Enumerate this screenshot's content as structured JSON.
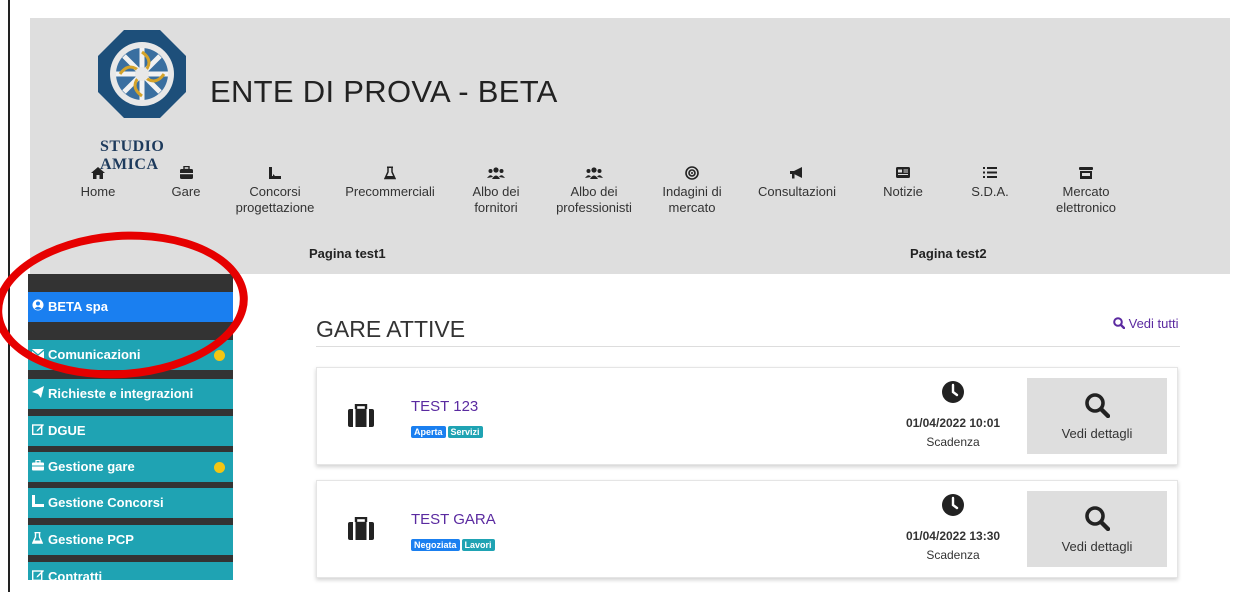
{
  "header": {
    "logo_text": "STUDIO AMICA",
    "site_title": "ENTE DI PROVA - BETA"
  },
  "nav": [
    {
      "label": "Home",
      "icon": "home-icon"
    },
    {
      "label": "Gare",
      "icon": "briefcase-icon"
    },
    {
      "label": "Concorsi progettazione",
      "icon": "drafting-icon"
    },
    {
      "label": "Precommerciali",
      "icon": "flask-icon"
    },
    {
      "label": "Albo dei fornitori",
      "icon": "users-icon"
    },
    {
      "label": "Albo dei professionisti",
      "icon": "users-icon"
    },
    {
      "label": "Indagini di mercato",
      "icon": "target-icon"
    },
    {
      "label": "Consultazioni",
      "icon": "megaphone-icon"
    },
    {
      "label": "Notizie",
      "icon": "newspaper-icon"
    },
    {
      "label": "S.D.A.",
      "icon": "list-icon"
    },
    {
      "label": "Mercato elettronico",
      "icon": "store-icon"
    }
  ],
  "subnav": {
    "page1": "Pagina test1",
    "page2": "Pagina test2"
  },
  "sidebar": {
    "items": [
      {
        "label": "BETA spa",
        "icon": "user-circle-icon"
      },
      {
        "label": "Comunicazioni",
        "icon": "envelope-icon",
        "dot": true
      },
      {
        "label": "Richieste e integrazioni",
        "icon": "paper-plane-icon"
      },
      {
        "label": "DGUE",
        "icon": "edit-icon"
      },
      {
        "label": "Gestione gare",
        "icon": "briefcase-icon",
        "dot": true
      },
      {
        "label": "Gestione Concorsi",
        "icon": "drafting-icon"
      },
      {
        "label": "Gestione PCP",
        "icon": "flask-icon"
      },
      {
        "label": "Contratti",
        "icon": "edit-icon"
      }
    ]
  },
  "main": {
    "section_title": "GARE ATTIVE",
    "see_all": "Vedi tutti",
    "tenders": [
      {
        "title": "TEST 123",
        "badges": [
          "Aperta",
          "Servizi"
        ],
        "deadline": "01/04/2022 10:01",
        "deadline_label": "Scadenza",
        "details_label": "Vedi dettagli"
      },
      {
        "title": "TEST GARA",
        "badges": [
          "Negoziata",
          "Lavori"
        ],
        "deadline": "01/04/2022 13:30",
        "deadline_label": "Scadenza",
        "details_label": "Vedi dettagli"
      }
    ]
  },
  "colors": {
    "header_bg": "#dedede",
    "active_blue": "#1a7ff0",
    "teal": "#1fa3b3",
    "accent_purple": "#5a2aa0",
    "notification_dot": "#f3c613",
    "annotation_red": "#e60000"
  }
}
